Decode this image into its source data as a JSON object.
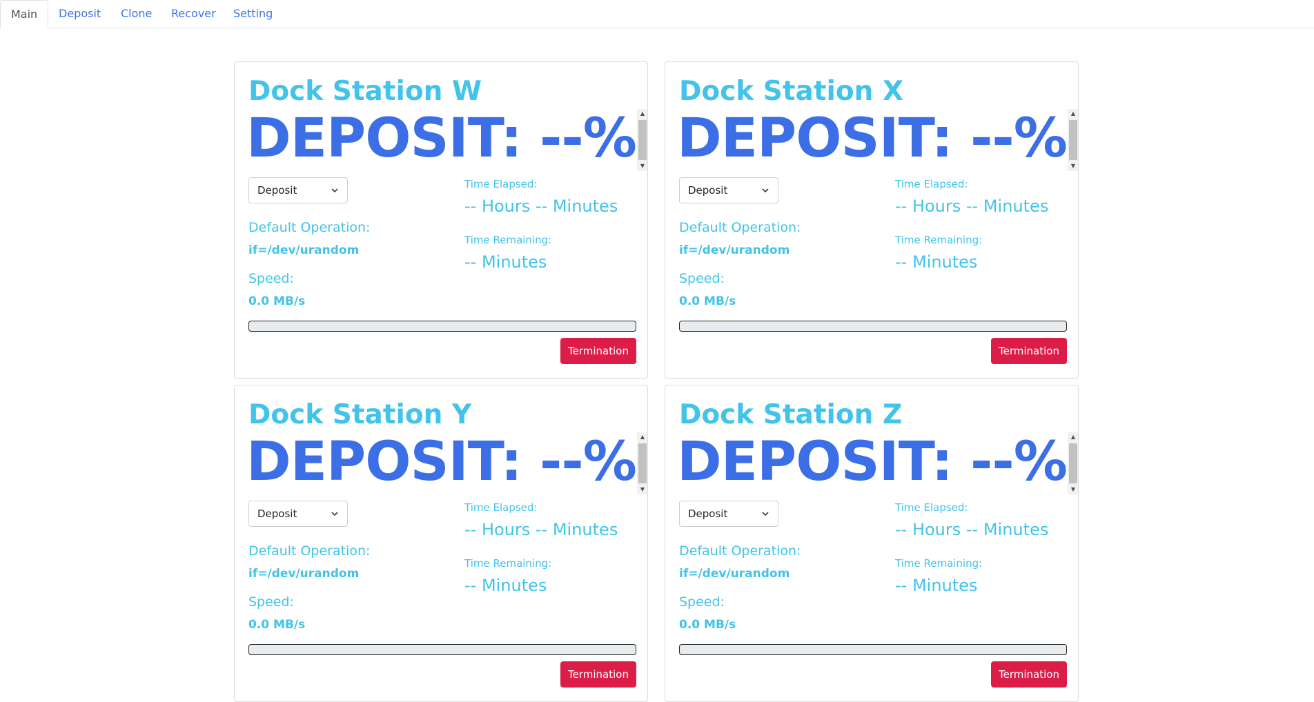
{
  "tabs": [
    {
      "label": "Main",
      "active": true
    },
    {
      "label": "Deposit",
      "active": false
    },
    {
      "label": "Clone",
      "active": false
    },
    {
      "label": "Recover",
      "active": false
    },
    {
      "label": "Setting",
      "active": false
    }
  ],
  "colors": {
    "title": "#41c3ea",
    "deposit": "#3c6ee6",
    "termination_button": "#dc1d48",
    "tab_link": "#3d73e6"
  },
  "stations": [
    {
      "title": "Dock Station W",
      "deposit_text": "DEPOSIT: --%",
      "mode_select": "Deposit",
      "default_operation_label": "Default Operation:",
      "default_operation_value": "if=/dev/urandom",
      "speed_label": "Speed:",
      "speed_value": "0.0 MB/s",
      "time_elapsed_label": "Time Elapsed:",
      "time_elapsed_value": "-- Hours -- Minutes",
      "time_remaining_label": "Time Remaining:",
      "time_remaining_value": "-- Minutes",
      "progress": 0,
      "termination_label": "Termination"
    },
    {
      "title": "Dock Station X",
      "deposit_text": "DEPOSIT: --%",
      "mode_select": "Deposit",
      "default_operation_label": "Default Operation:",
      "default_operation_value": "if=/dev/urandom",
      "speed_label": "Speed:",
      "speed_value": "0.0 MB/s",
      "time_elapsed_label": "Time Elapsed:",
      "time_elapsed_value": "-- Hours -- Minutes",
      "time_remaining_label": "Time Remaining:",
      "time_remaining_value": "-- Minutes",
      "progress": 0,
      "termination_label": "Termination"
    },
    {
      "title": "Dock Station Y",
      "deposit_text": "DEPOSIT: --%",
      "mode_select": "Deposit",
      "default_operation_label": "Default Operation:",
      "default_operation_value": "if=/dev/urandom",
      "speed_label": "Speed:",
      "speed_value": "0.0 MB/s",
      "time_elapsed_label": "Time Elapsed:",
      "time_elapsed_value": "-- Hours -- Minutes",
      "time_remaining_label": "Time Remaining:",
      "time_remaining_value": "-- Minutes",
      "progress": 0,
      "termination_label": "Termination"
    },
    {
      "title": "Dock Station Z",
      "deposit_text": "DEPOSIT: --%",
      "mode_select": "Deposit",
      "default_operation_label": "Default Operation:",
      "default_operation_value": "if=/dev/urandom",
      "speed_label": "Speed:",
      "speed_value": "0.0 MB/s",
      "time_elapsed_label": "Time Elapsed:",
      "time_elapsed_value": "-- Hours -- Minutes",
      "time_remaining_label": "Time Remaining:",
      "time_remaining_value": "-- Minutes",
      "progress": 0,
      "termination_label": "Termination"
    }
  ]
}
